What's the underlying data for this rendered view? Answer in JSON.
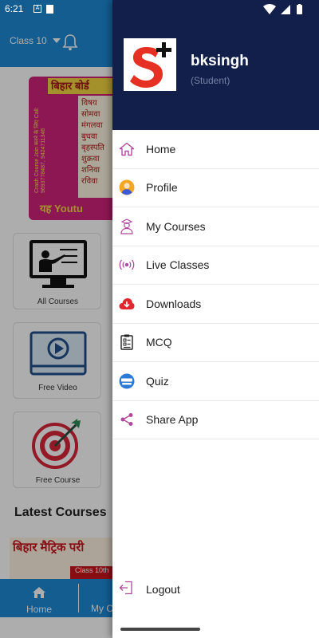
{
  "status_bar": {
    "time": "6:21",
    "notification_icons": [
      "a-icon",
      "sd-card-icon"
    ],
    "system_icons": [
      "wifi-icon",
      "signal-icon",
      "battery-icon"
    ]
  },
  "app": {
    "class_selector": "Class 10",
    "banner": {
      "title": "बिहार बोर्ड",
      "lines": [
        "विषय",
        "सोमवा",
        "मंगलवा",
        "बुधवा",
        "बृहस्पति",
        "शुक्रवा",
        "शनिवा",
        "रविवा"
      ],
      "side_text": "Crash Course Join करने के लिए Call: 9693778487, 9424711346",
      "footer": "यह Youtu"
    },
    "tiles": [
      {
        "label": "All Courses",
        "icon": "classroom-icon"
      },
      {
        "label": "Free Video",
        "icon": "video-play-icon"
      },
      {
        "label": "Free Course",
        "icon": "target-icon"
      }
    ],
    "latest_courses_heading": "Latest Courses",
    "course_thumb": {
      "title": "बिहार मैट्रिक परी",
      "strip": "Class 10th"
    },
    "bottom_nav": {
      "home": "Home",
      "my_courses": "My C"
    }
  },
  "drawer": {
    "user": {
      "name": "bksingh",
      "role": "(Student)"
    },
    "logo_letter": "S",
    "menu": [
      {
        "label": "Home",
        "icon": "home-icon"
      },
      {
        "label": "Profile",
        "icon": "profile-icon"
      },
      {
        "label": "My Courses",
        "icon": "student-icon"
      },
      {
        "label": "Live Classes",
        "icon": "broadcast-icon"
      },
      {
        "label": "Downloads",
        "icon": "cloud-download-icon"
      },
      {
        "label": "MCQ",
        "icon": "checklist-icon"
      },
      {
        "label": "Quiz",
        "icon": "quiz-icon"
      },
      {
        "label": "Share App",
        "icon": "share-icon"
      }
    ],
    "logout": {
      "label": "Logout",
      "icon": "logout-icon"
    }
  },
  "colors": {
    "app_primary": "#1c8ad6",
    "drawer_header": "#121f4a",
    "menu_icon_purple": "#b0489c",
    "logo_red": "#e53023"
  }
}
